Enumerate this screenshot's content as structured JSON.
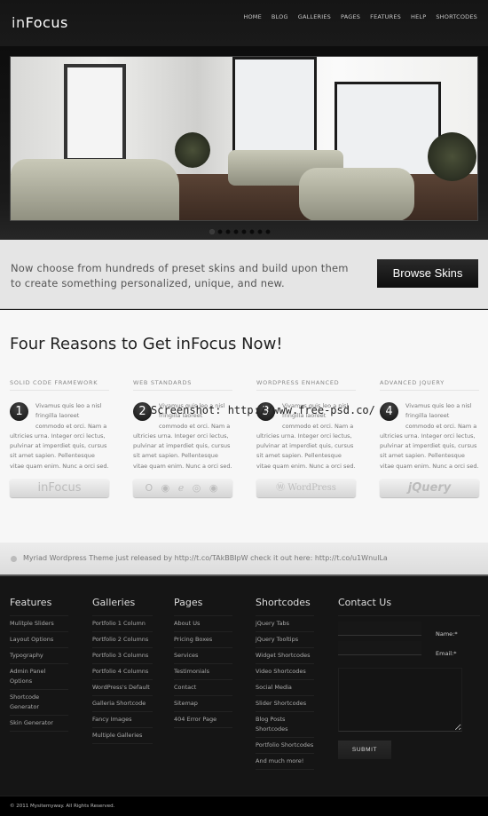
{
  "header": {
    "logo_in": "in",
    "logo_focus": "Focus",
    "nav": [
      "HOME",
      "BLOG",
      "GALLERIES",
      "PAGES",
      "FEATURES",
      "HELP",
      "SHORTCODES"
    ]
  },
  "slider": {
    "slide_count": 8,
    "active_index": 0
  },
  "promo": {
    "text": "Now choose from hundreds of preset skins and build upon them to create something personalized, unique, and new.",
    "button": "Browse Skins"
  },
  "main": {
    "title": "Four Reasons to Get inFocus Now!",
    "columns": [
      {
        "heading": "SOLID CODE FRAMEWORK",
        "number": "1",
        "body": "Vivamus quis leo a nisl fringilla laoreet commodo et orci. Nam a ultricies urna. Integer orci lectus, pulvinar at imperdiet quis, cursus sit amet sapien. Pellentesque vitae quam enim. Nunc a orci sed.",
        "badge": "inFocus"
      },
      {
        "heading": "WEB STANDARDS",
        "number": "2",
        "body": "Vivamus quis leo a nisl fringilla laoreet commodo et orci. Nam a ultricies urna. Integer orci lectus, pulvinar at imperdiet quis, cursus sit amet sapien. Pellentesque vitae quam enim. Nunc a orci sed.",
        "badge": "browser-icons"
      },
      {
        "heading": "WORDPRESS ENHANCED",
        "number": "3",
        "body": "Vivamus quis leo a nisl fringilla laoreet commodo et orci. Nam a ultricies urna. Integer orci lectus, pulvinar at imperdiet quis, cursus sit amet sapien. Pellentesque vitae quam enim. Nunc a orci sed.",
        "badge": "WordPress"
      },
      {
        "heading": "ADVANCED JQUERY",
        "number": "4",
        "body": "Vivamus quis leo a nisl fringilla laoreet commodo et orci. Nam a ultricies urna. Integer orci lectus, pulvinar at imperdiet quis, cursus sit amet sapien. Pellentesque vitae quam enim. Nunc a orci sed.",
        "badge": "jQuery"
      }
    ]
  },
  "twitter": {
    "text": "Myriad Wordpress Theme just released by http://t.co/TAkBBIpW check it out here: http://t.co/u1WnulLa"
  },
  "footer": {
    "features": {
      "title": "Features",
      "items": [
        "Mulitple Sliders",
        "Layout Options",
        "Typography",
        "Admin Panel Options",
        "Shortcode Generator",
        "Skin Generator"
      ]
    },
    "galleries": {
      "title": "Galleries",
      "items": [
        "Portfolio 1 Column",
        "Portfolio 2 Columns",
        "Portfolio 3 Columns",
        "Portfolio 4 Columns",
        "WordPress's Default",
        "Galleria Shortcode",
        "Fancy Images",
        "Multiple Galleries"
      ]
    },
    "pages": {
      "title": "Pages",
      "items": [
        "About Us",
        "Pricing Boxes",
        "Services",
        "Testimonials",
        "Contact",
        "Sitemap",
        "404 Error Page"
      ]
    },
    "shortcodes": {
      "title": "Shortcodes",
      "items": [
        "jQuery Tabs",
        "jQuery Tooltips",
        "Widget Shortcodes",
        "Video Shortcodes",
        "Social Media",
        "Slider Shortcodes",
        "Blog Posts Shortcodes",
        "Portfolio Shortcodes",
        "And much more!"
      ]
    },
    "contact": {
      "title": "Contact Us",
      "name_label": "Name:*",
      "email_label": "Email:*",
      "name_value": "",
      "email_value": "",
      "message_value": "",
      "submit": "SUBMIT"
    }
  },
  "copyright": "© 2011 Mysitemyway. All Rights Reserved.",
  "watermark": "Screenshot: http://www.free-psd.co/"
}
